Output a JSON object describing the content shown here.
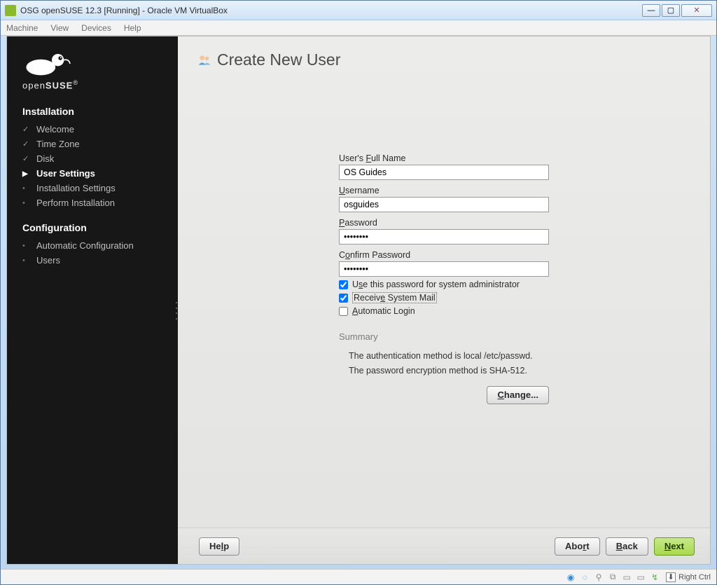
{
  "window": {
    "title": "OSG openSUSE 12.3 [Running] - Oracle VM VirtualBox"
  },
  "vbox_menu": {
    "machine": "Machine",
    "view": "View",
    "devices": "Devices",
    "help": "Help"
  },
  "sidebar": {
    "brand_open": "open",
    "brand_suse": "SUSE",
    "section_install": "Installation",
    "section_config": "Configuration",
    "install_items": [
      {
        "label": "Welcome",
        "state": "done"
      },
      {
        "label": "Time Zone",
        "state": "done"
      },
      {
        "label": "Disk",
        "state": "done"
      },
      {
        "label": "User Settings",
        "state": "current"
      },
      {
        "label": "Installation Settings",
        "state": "pending"
      },
      {
        "label": "Perform Installation",
        "state": "pending"
      }
    ],
    "config_items": [
      {
        "label": "Automatic Configuration",
        "state": "pending"
      },
      {
        "label": "Users",
        "state": "pending"
      }
    ]
  },
  "page": {
    "title": "Create New User",
    "fullname_label": "User's Full Name",
    "fullname_value": "OS Guides",
    "username_label": "Username",
    "username_value": "osguides",
    "password_label": "Password",
    "password_value": "••••••••",
    "confirm_label": "Confirm Password",
    "confirm_value": "••••••••",
    "chk_sysadmin": "Use this password for system administrator",
    "chk_sysmail": "Receive System Mail",
    "chk_autologin": "Automatic Login",
    "summary_title": "Summary",
    "summary_line1": "The authentication method is local /etc/passwd.",
    "summary_line2": "The password encryption method is SHA-512.",
    "change_btn": "Change..."
  },
  "buttons": {
    "help": "Help",
    "abort": "Abort",
    "back": "Back",
    "next": "Next"
  },
  "statusbar": {
    "hostkey": "Right Ctrl"
  }
}
